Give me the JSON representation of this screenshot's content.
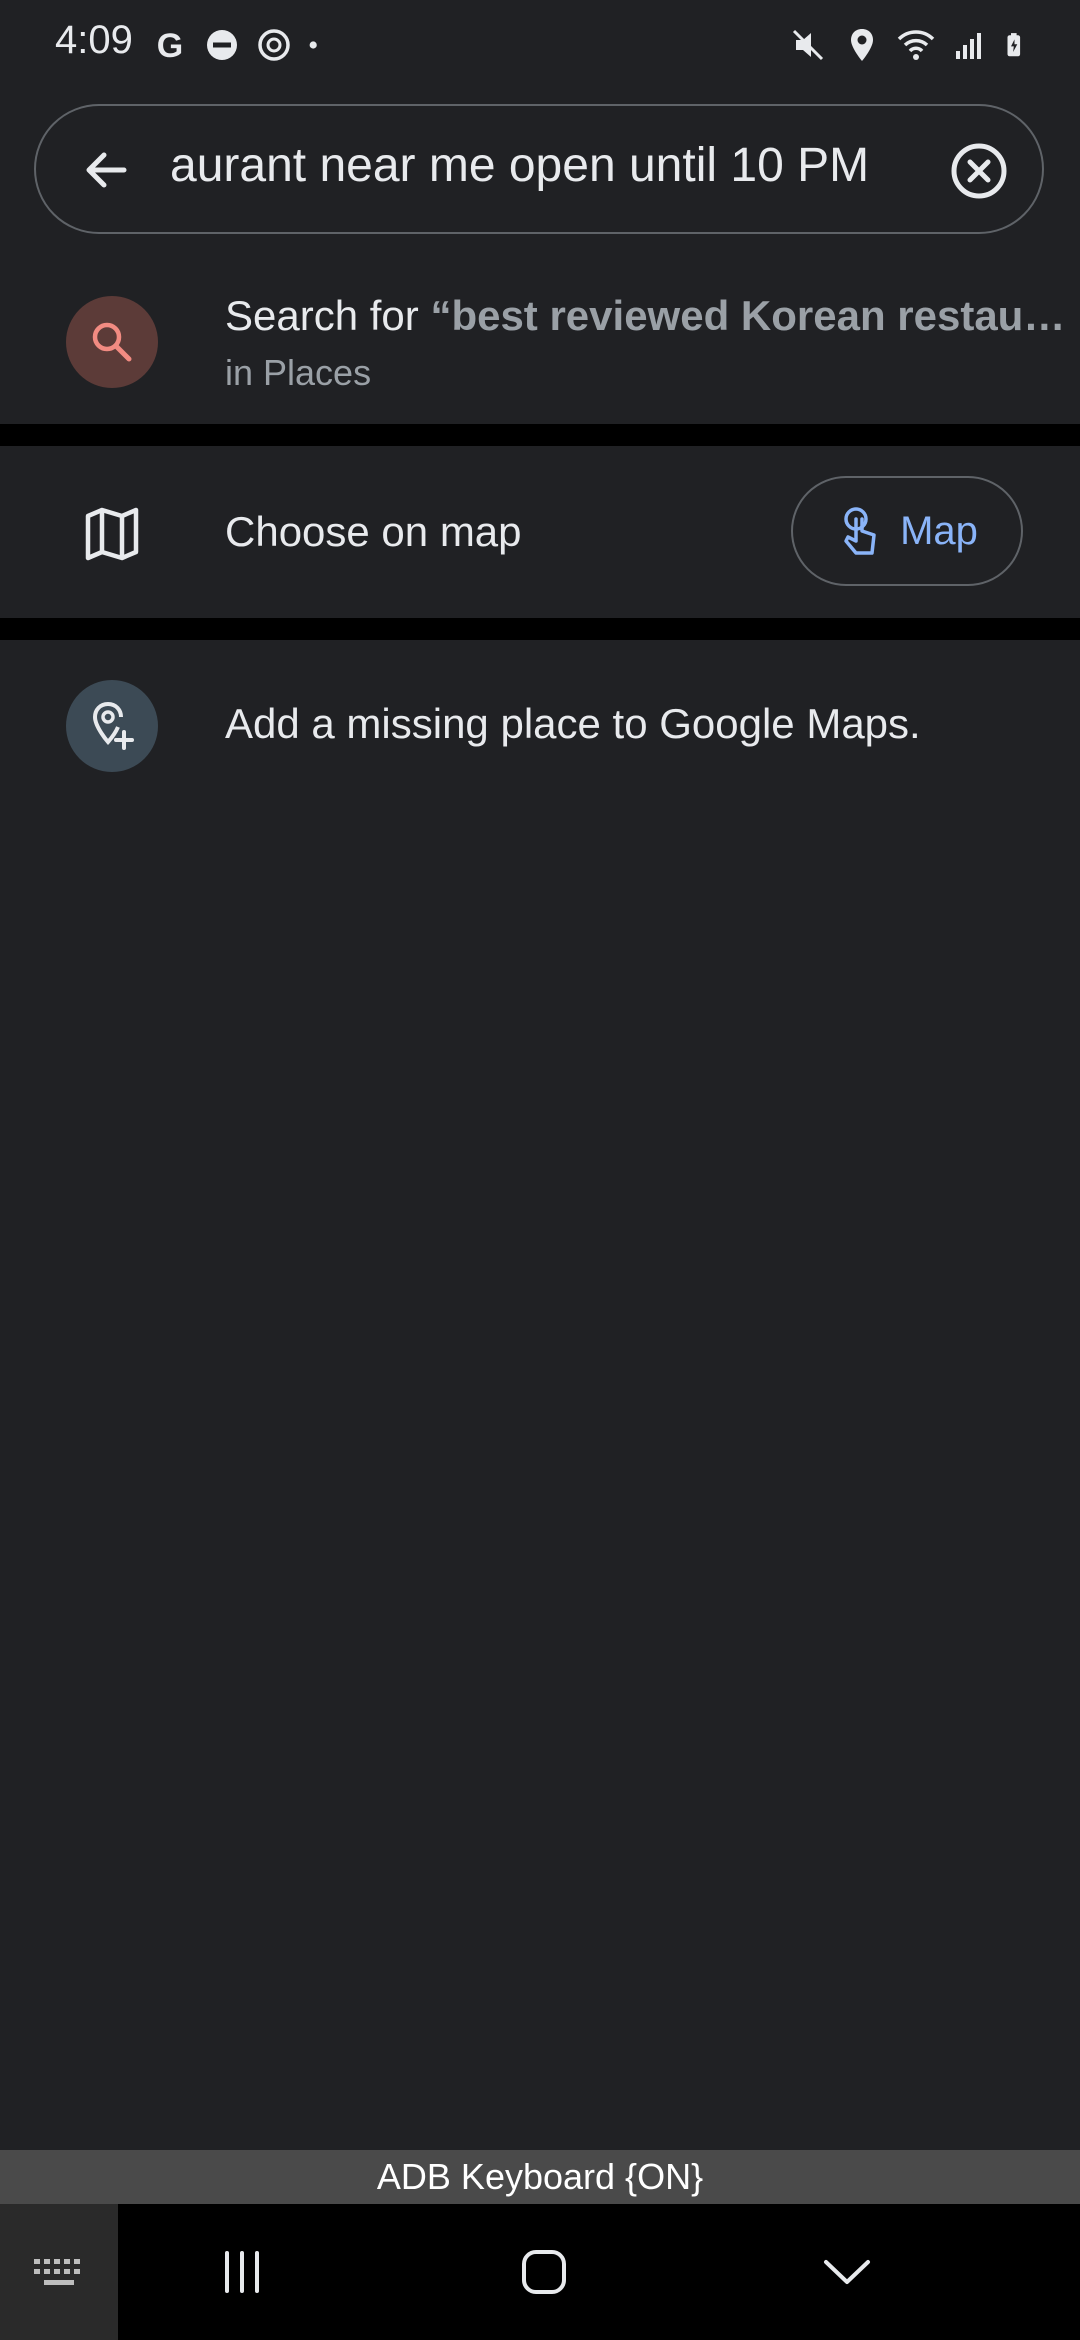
{
  "status_bar": {
    "time": "4:09",
    "left_icons": [
      "google-g-icon",
      "do-not-disturb-icon",
      "sync-icon",
      "dot-icon"
    ],
    "right_icons": [
      "mute-icon",
      "location-icon",
      "wifi-icon",
      "signal-icon",
      "battery-charging-icon"
    ]
  },
  "search": {
    "query_visible": "aurant near me open until 10 PM"
  },
  "suggestion": {
    "prefix": "Search for ",
    "query": "“best reviewed Korean restau…",
    "subtitle": "in Places"
  },
  "choose_on_map": {
    "label": "Choose on map",
    "button_label": "Map"
  },
  "add_place": {
    "label": "Add a missing place to Google Maps."
  },
  "keyboard_banner": {
    "text": "ADB Keyboard {ON}"
  },
  "colors": {
    "background": "#202124",
    "accent_blue": "#8ab4f8",
    "search_icon_red": "#f28b82",
    "secondary_text": "#9aa0a6"
  }
}
